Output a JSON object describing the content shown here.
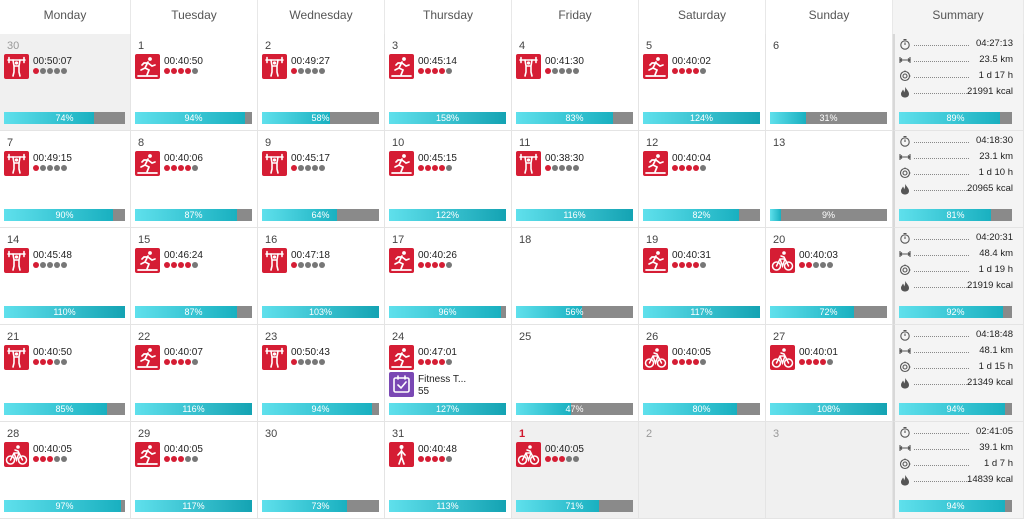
{
  "headers": [
    "Monday",
    "Tuesday",
    "Wednesday",
    "Thursday",
    "Friday",
    "Saturday",
    "Sunday",
    "Summary"
  ],
  "weeks": [
    {
      "days": [
        {
          "num": "30",
          "style": "dim",
          "bg": "grey",
          "acts": [
            {
              "type": "strength",
              "time": "00:50:07",
              "dots": 1
            }
          ],
          "pct": 74,
          "label": "74%"
        },
        {
          "num": "1",
          "acts": [
            {
              "type": "run",
              "time": "00:40:50",
              "dots": 4
            }
          ],
          "pct": 94,
          "label": "94%"
        },
        {
          "num": "2",
          "acts": [
            {
              "type": "strength",
              "time": "00:49:27",
              "dots": 1
            }
          ],
          "pct": 58,
          "label": "58%"
        },
        {
          "num": "3",
          "acts": [
            {
              "type": "run",
              "time": "00:45:14",
              "dots": 4
            }
          ],
          "pct": 158,
          "label": "158%"
        },
        {
          "num": "4",
          "acts": [
            {
              "type": "strength",
              "time": "00:41:30",
              "dots": 1
            }
          ],
          "pct": 83,
          "label": "83%"
        },
        {
          "num": "5",
          "acts": [
            {
              "type": "run",
              "time": "00:40:02",
              "dots": 4
            }
          ],
          "pct": 124,
          "label": "124%"
        },
        {
          "num": "6",
          "acts": [],
          "pct": 31,
          "label": "31%"
        }
      ],
      "summary": {
        "time": "04:27:13",
        "distance": "23.5 km",
        "duration": "1 d 17 h",
        "kcal": "21991 kcal",
        "pct": 89,
        "label": "89%"
      }
    },
    {
      "days": [
        {
          "num": "7",
          "acts": [
            {
              "type": "strength",
              "time": "00:49:15",
              "dots": 1
            }
          ],
          "pct": 90,
          "label": "90%"
        },
        {
          "num": "8",
          "acts": [
            {
              "type": "run",
              "time": "00:40:06",
              "dots": 4
            }
          ],
          "pct": 87,
          "label": "87%"
        },
        {
          "num": "9",
          "acts": [
            {
              "type": "strength",
              "time": "00:45:17",
              "dots": 1
            }
          ],
          "pct": 64,
          "label": "64%"
        },
        {
          "num": "10",
          "acts": [
            {
              "type": "run",
              "time": "00:45:15",
              "dots": 4
            }
          ],
          "pct": 122,
          "label": "122%"
        },
        {
          "num": "11",
          "acts": [
            {
              "type": "strength",
              "time": "00:38:30",
              "dots": 1
            }
          ],
          "pct": 116,
          "label": "116%"
        },
        {
          "num": "12",
          "acts": [
            {
              "type": "run",
              "time": "00:40:04",
              "dots": 4
            }
          ],
          "pct": 82,
          "label": "82%"
        },
        {
          "num": "13",
          "acts": [],
          "pct": 9,
          "label": "9%"
        }
      ],
      "summary": {
        "time": "04:18:30",
        "distance": "23.1 km",
        "duration": "1 d 10 h",
        "kcal": "20965 kcal",
        "pct": 81,
        "label": "81%"
      }
    },
    {
      "days": [
        {
          "num": "14",
          "acts": [
            {
              "type": "strength",
              "time": "00:45:48",
              "dots": 1
            }
          ],
          "pct": 110,
          "label": "110%"
        },
        {
          "num": "15",
          "acts": [
            {
              "type": "run",
              "time": "00:46:24",
              "dots": 4
            }
          ],
          "pct": 87,
          "label": "87%"
        },
        {
          "num": "16",
          "acts": [
            {
              "type": "strength",
              "time": "00:47:18",
              "dots": 1
            }
          ],
          "pct": 103,
          "label": "103%"
        },
        {
          "num": "17",
          "acts": [
            {
              "type": "run",
              "time": "00:40:26",
              "dots": 4
            }
          ],
          "pct": 96,
          "label": "96%"
        },
        {
          "num": "18",
          "acts": [],
          "pct": 56,
          "label": "56%"
        },
        {
          "num": "19",
          "acts": [
            {
              "type": "run",
              "time": "00:40:31",
              "dots": 4
            }
          ],
          "pct": 117,
          "label": "117%"
        },
        {
          "num": "20",
          "acts": [
            {
              "type": "cycle",
              "time": "00:40:03",
              "dots": 2
            }
          ],
          "pct": 72,
          "label": "72%"
        }
      ],
      "summary": {
        "time": "04:20:31",
        "distance": "48.4 km",
        "duration": "1 d 19 h",
        "kcal": "21919 kcal",
        "pct": 92,
        "label": "92%"
      }
    },
    {
      "days": [
        {
          "num": "21",
          "acts": [
            {
              "type": "strength",
              "time": "00:40:50",
              "dots": 3
            }
          ],
          "pct": 85,
          "label": "85%"
        },
        {
          "num": "22",
          "acts": [
            {
              "type": "run",
              "time": "00:40:07",
              "dots": 4
            }
          ],
          "pct": 116,
          "label": "116%"
        },
        {
          "num": "23",
          "acts": [
            {
              "type": "strength",
              "time": "00:50:43",
              "dots": 1
            }
          ],
          "pct": 94,
          "label": "94%"
        },
        {
          "num": "24",
          "acts": [
            {
              "type": "run",
              "time": "00:47:01",
              "dots": 4
            },
            {
              "type": "fitness",
              "name": "Fitness T...",
              "value": "55"
            }
          ],
          "pct": 127,
          "label": "127%"
        },
        {
          "num": "25",
          "acts": [],
          "pct": 47,
          "label": "47%"
        },
        {
          "num": "26",
          "acts": [
            {
              "type": "cycle",
              "time": "00:40:05",
              "dots": 4
            }
          ],
          "pct": 80,
          "label": "80%"
        },
        {
          "num": "27",
          "acts": [
            {
              "type": "cycle",
              "time": "00:40:01",
              "dots": 4
            }
          ],
          "pct": 108,
          "label": "108%"
        }
      ],
      "summary": {
        "time": "04:18:48",
        "distance": "48.1 km",
        "duration": "1 d 15 h",
        "kcal": "21349 kcal",
        "pct": 94,
        "label": "94%"
      }
    },
    {
      "days": [
        {
          "num": "28",
          "acts": [
            {
              "type": "cycle",
              "time": "00:40:05",
              "dots": 3
            }
          ],
          "pct": 97,
          "label": "97%"
        },
        {
          "num": "29",
          "acts": [
            {
              "type": "run",
              "time": "00:40:05",
              "dots": 3
            }
          ],
          "pct": 117,
          "label": "117%"
        },
        {
          "num": "30",
          "acts": [],
          "pct": 73,
          "label": "73%"
        },
        {
          "num": "31",
          "acts": [
            {
              "type": "walk",
              "time": "00:40:48",
              "dots": 4
            }
          ],
          "pct": 113,
          "label": "113%"
        },
        {
          "num": "1",
          "style": "red",
          "bg": "grey",
          "acts": [
            {
              "type": "cycle",
              "time": "00:40:05",
              "dots": 3
            }
          ],
          "pct": 71,
          "label": "71%"
        },
        {
          "num": "2",
          "style": "dim",
          "bg": "grey",
          "acts": [],
          "pct": null,
          "label": ""
        },
        {
          "num": "3",
          "style": "dim",
          "bg": "grey",
          "acts": [],
          "pct": null,
          "label": ""
        }
      ],
      "summary": {
        "time": "02:41:05",
        "distance": "39.1 km",
        "duration": "1 d 7 h",
        "kcal": "14839 kcal",
        "pct": 94,
        "label": "94%"
      }
    }
  ],
  "colors": {
    "accent": "#d51d34",
    "bar_fill": "#19b0c0",
    "bar_track": "#8a8a8a",
    "fitness": "#7a48b4"
  },
  "summary_icons": [
    "stopwatch-icon",
    "distance-icon",
    "duration-icon",
    "calories-icon"
  ]
}
